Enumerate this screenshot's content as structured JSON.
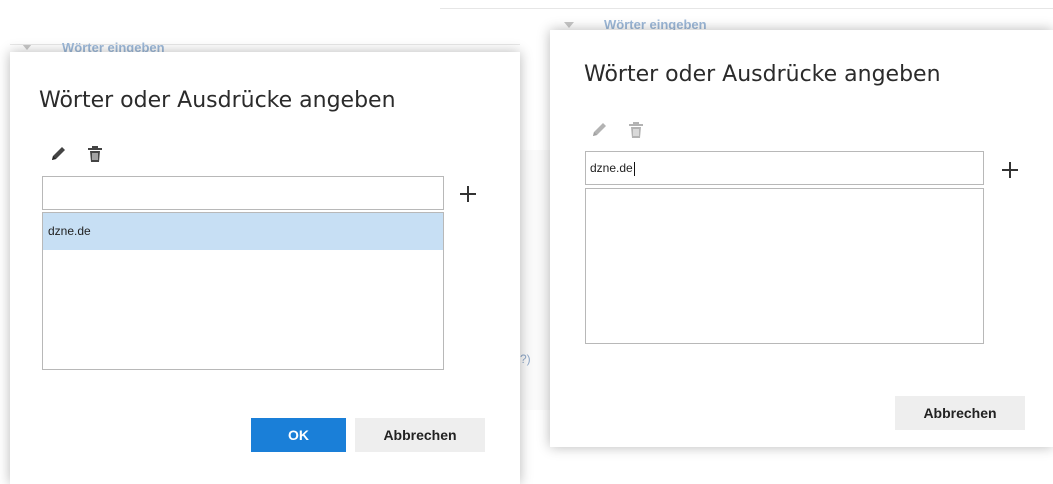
{
  "background": {
    "strip_label": "Wörter eingeben",
    "fragment": "?)"
  },
  "left_dialog": {
    "title": "Wörter oder Ausdrücke angeben",
    "icons": [
      "pencil-icon",
      "trash-icon",
      "plus-icon"
    ],
    "input": {
      "value": "",
      "placeholder": ""
    },
    "list_items": [
      {
        "label": "dzne.de",
        "selected": true
      }
    ],
    "ok_label": "OK",
    "cancel_label": "Abbrechen",
    "edit_enabled": true,
    "delete_enabled": true
  },
  "right_dialog": {
    "title": "Wörter oder Ausdrücke angeben",
    "icons": [
      "pencil-icon",
      "trash-icon",
      "plus-icon"
    ],
    "input": {
      "value": "dzne.de",
      "placeholder": ""
    },
    "list_items": [],
    "cancel_label": "Abbrechen",
    "edit_enabled": false,
    "delete_enabled": false
  },
  "colors": {
    "primary": "#1a7fd8",
    "selected_row": "#c7dff4",
    "icon_active": "#444444",
    "icon_disabled": "#b3b3b3"
  }
}
